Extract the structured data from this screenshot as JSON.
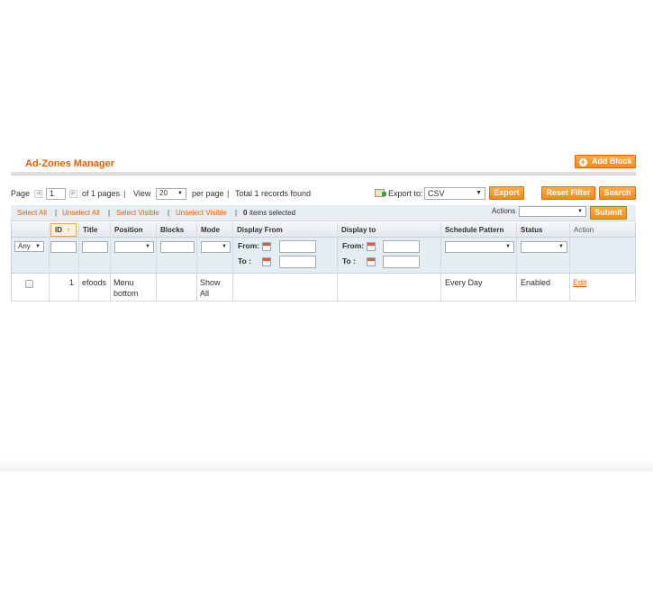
{
  "page": {
    "title": "Ad-Zones Manager",
    "add_button": "Add Block"
  },
  "pager": {
    "page_label": "Page",
    "page_value": "1",
    "of_pages": "of 1 pages",
    "view_label": "View",
    "per_page_value": "20",
    "per_page_label": "per page",
    "total": "Total 1 records found",
    "export_label": "Export to:",
    "export_format": "CSV",
    "export_button": "Export",
    "reset_button": "Reset Filter",
    "search_button": "Search"
  },
  "massaction": {
    "select_all": "Select All",
    "unselect_all": "Unselect All",
    "select_visible": "Select Visible",
    "unselect_visible": "Unselect Visible",
    "separator": "|",
    "selected_count": "0",
    "selected_suffix": "items selected",
    "actions_label": "Actions",
    "submit_button": "Submit"
  },
  "grid": {
    "columns": {
      "id": "ID",
      "title": "Title",
      "position": "Position",
      "blocks": "Blocks",
      "mode": "Mode",
      "display_from": "Display From",
      "display_to": "Display to",
      "schedule": "Schedule Pattern",
      "status": "Status",
      "action": "Action"
    },
    "filters": {
      "massaction_any": "Any",
      "from_label": "From:",
      "to_label": "To :"
    },
    "rows": [
      {
        "id": "1",
        "title": "efoods",
        "position": "Menu bottom",
        "blocks": "",
        "mode": "Show All",
        "display_from": "",
        "display_to": "",
        "schedule": "Every Day",
        "status": "Enabled",
        "action": "Edit"
      }
    ]
  },
  "icons": {
    "sort": "arrow-up-icon",
    "calendar": "calendar-icon",
    "export": "export-icon",
    "add": "plus-icon"
  },
  "colors": {
    "accent": "#eb5e00",
    "button": "#f48a1a",
    "header_bg": "#e7eef2"
  }
}
